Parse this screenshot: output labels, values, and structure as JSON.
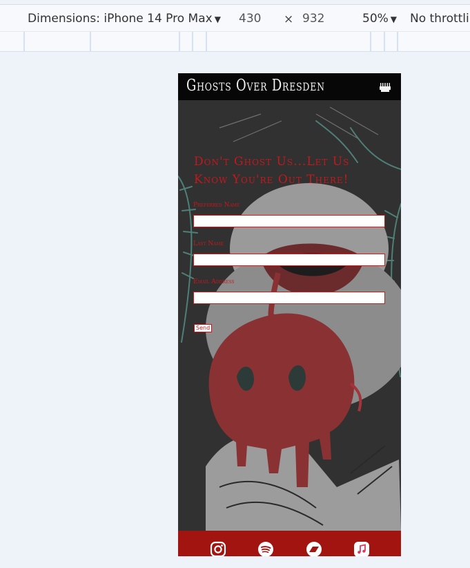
{
  "devtools": {
    "dimensions_label": "Dimensions: iPhone 14 Pro Max",
    "width": "430",
    "times": "×",
    "height": "932",
    "zoom": "50%",
    "throttling": "No throttlin"
  },
  "site": {
    "title": "Ghosts Over Dresden",
    "menu_icon": "menu-icon"
  },
  "form": {
    "heading": "Don't Ghost Us...Let Us Know You're Out There!",
    "fields": [
      {
        "label": "Preferred Name",
        "value": ""
      },
      {
        "label": "Last Name",
        "value": ""
      },
      {
        "label": "Email Address",
        "value": ""
      }
    ],
    "send_label": "Send"
  },
  "footer": {
    "icons": [
      "instagram-icon",
      "spotify-icon",
      "bandcamp-icon",
      "apple-music-icon"
    ]
  },
  "colors": {
    "accent_red": "#c3191c",
    "footer_red": "#a2140f",
    "header_black": "#070707"
  }
}
